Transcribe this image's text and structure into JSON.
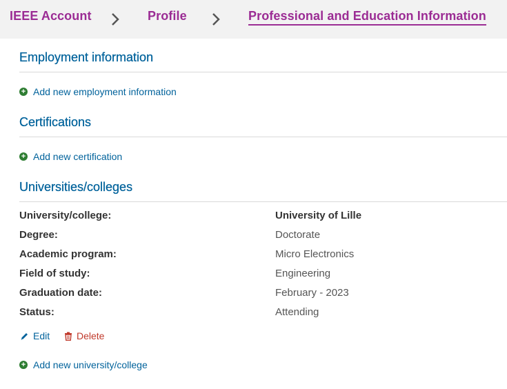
{
  "breadcrumb": {
    "items": [
      "IEEE Account",
      "Profile"
    ],
    "current": "Professional and Education Information"
  },
  "sections": {
    "employment": {
      "title": "Employment information",
      "add_label": "Add new employment information"
    },
    "certifications": {
      "title": "Certifications",
      "add_label": "Add new certification"
    },
    "universities": {
      "title": "Universities/colleges",
      "fields": [
        {
          "label": "University/college:",
          "value": "University of Lille"
        },
        {
          "label": "Degree:",
          "value": "Doctorate"
        },
        {
          "label": "Academic program:",
          "value": "Micro Electronics"
        },
        {
          "label": "Field of study:",
          "value": "Engineering"
        },
        {
          "label": "Graduation date:",
          "value": "February - 2023"
        },
        {
          "label": "Status:",
          "value": "Attending"
        }
      ],
      "edit_label": "Edit",
      "delete_label": "Delete",
      "add_label": "Add new university/college"
    }
  },
  "colors": {
    "brand_purple": "#9b2c94",
    "link_blue": "#00629b",
    "add_green": "#2e7d32",
    "delete_red": "#c0392b"
  },
  "icons": [
    "chevron-right-icon",
    "plus-circle-icon",
    "pencil-icon",
    "trash-icon"
  ]
}
